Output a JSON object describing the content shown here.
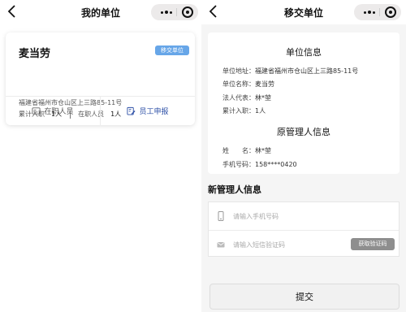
{
  "left": {
    "nav": {
      "title": "我的单位"
    },
    "unit": {
      "name": "麦当劳",
      "badge": "移交单位",
      "address": "福建省福州市仓山区上三路85-11号",
      "cumulative_label": "累计入职",
      "cumulative_value": "1人",
      "current_label": "在职人员",
      "current_value": "1人"
    },
    "actions": {
      "staff_label": "在职人员",
      "apply_label": "员工申报"
    },
    "colors": {
      "badge": "#67a6e8",
      "apply_text": "#2c4fa6"
    }
  },
  "right": {
    "nav": {
      "title": "移交单位"
    },
    "unit_info": {
      "title": "单位信息",
      "address_label": "单位地址：",
      "address": "福建省福州市仓山区上三路85-11号",
      "name_label": "单位名称：",
      "name": "麦当劳",
      "rep_label": "法人代表：",
      "rep": "林*堃",
      "cumulative_label": "累计入职：",
      "cumulative": "1人"
    },
    "old_manager": {
      "title": "原管理人信息",
      "name_label": "姓　　名：",
      "name": "林*堃",
      "phone_label": "手机号码：",
      "phone": "158****0420"
    },
    "new_manager": {
      "title": "新管理人信息",
      "phone_placeholder": "请输入手机号码",
      "code_placeholder": "请输入短信验证码",
      "get_code_label": "获取验证码"
    },
    "submit_label": "提交"
  },
  "icons": {
    "back": "chevron-left-icon",
    "more": "more-dots-icon",
    "close": "circle-close-icon",
    "staff": "id-card-icon",
    "apply": "edit-form-icon",
    "phone": "mobile-phone-icon",
    "mail": "envelope-icon"
  }
}
